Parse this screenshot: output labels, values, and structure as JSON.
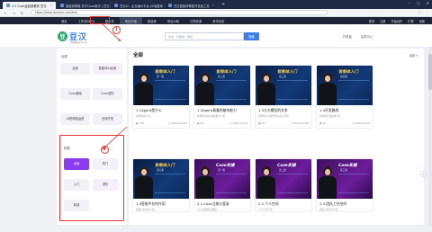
{
  "browser": {
    "tabs": [
      {
        "label": "2.3 Coze运营报看家 豆汉",
        "active": true
      },
      {
        "label": "智能体教程 扣子Coze新手 | 豆汉",
        "active": false
      },
      {
        "label": "豆汉AI - 企业级AI平台 |AI智能体",
        "active": false
      },
      {
        "label": "豆汉智能体教程开发者工具",
        "active": false
      }
    ],
    "new_tab": "+",
    "url": "https://www.douhan.com/find",
    "window_controls": [
      "–",
      "□",
      "✕"
    ],
    "addr_right": [
      "☆",
      "⋮"
    ]
  },
  "appnav": {
    "items": [
      "首页",
      "工作流BETA",
      "提示词",
      "项目宇宙",
      "智能体",
      "项目AI网",
      "已购资源",
      "资讯动态"
    ],
    "highlighted_index": 3,
    "right": [
      "登录",
      "注册",
      "开始创作",
      "扩展",
      "设置"
    ]
  },
  "header": {
    "logo_mark": "豆",
    "logo_text": "豆汉",
    "logo_sub": "AI智能体学习平台",
    "search_placeholder": "搜索 - 智能体、教程",
    "search_button": "搜索",
    "links": [
      "开发者",
      "会员中心"
    ]
  },
  "sidebar": {
    "section1_title": "分类",
    "section1_items": [
      "全部",
      "智能体AI应用",
      "Coze基础",
      "Coze进阶",
      "AI短视频运营",
      "全栈开发"
    ],
    "section2_title": "标签",
    "section2_items": [
      "全部",
      "热门",
      "入门",
      "进阶",
      "精选"
    ],
    "selected_tag": "全部"
  },
  "main": {
    "title": "全部",
    "more": "最新 ▾",
    "cards": [
      {
        "title": "1.1Agent是什么",
        "desc": "智能体是什么？",
        "views": "176",
        "date": "2025-10-29",
        "thumb_title": "智能体入门",
        "thumb_sub": "第一课"
      },
      {
        "title": "1.2Agent具备的基本能力",
        "desc": "智能体具备的基本能力介绍",
        "views": "93",
        "date": "2025-10-30",
        "thumb_title": "智能体入门",
        "thumb_sub": "第二课"
      },
      {
        "title": "1.3与大模型的关系",
        "desc": "智能体与大模型的关系与区别",
        "views": "48",
        "date": "2025-10-30",
        "thumb_title": "智能体入门",
        "thumb_sub": "第三课"
      },
      {
        "title": "1.4开发路线",
        "desc": "智能体开发路线分享",
        "views": "36",
        "date": "2025-10-30",
        "thumb_title": "智能体入门",
        "thumb_sub": "第四课"
      },
      {
        "title": "1.5智能平台的作用",
        "desc": "智能平台作用介绍",
        "views": "",
        "date": "",
        "thumb_title": "智能体入门",
        "thumb_sub": "第五课"
      },
      {
        "title": "2.1-Coze注册与登录",
        "desc": "Coze注册登录教程",
        "views": "",
        "date": "",
        "thumb_title": "Coze实操",
        "thumb_sub": "第一课"
      },
      {
        "title": "2.2-个人空间",
        "desc": "个人空间介绍",
        "views": "",
        "date": "",
        "thumb_title": "Coze实操",
        "thumb_sub": "第二课"
      },
      {
        "title": "2.3-团队工作空间",
        "desc": "团队工作空间介绍",
        "views": "",
        "date": "",
        "thumb_title": "Coze实操",
        "thumb_sub": "第三课"
      }
    ]
  },
  "annotations": {
    "circle1": "1",
    "circle2": "2"
  },
  "help": "?"
}
